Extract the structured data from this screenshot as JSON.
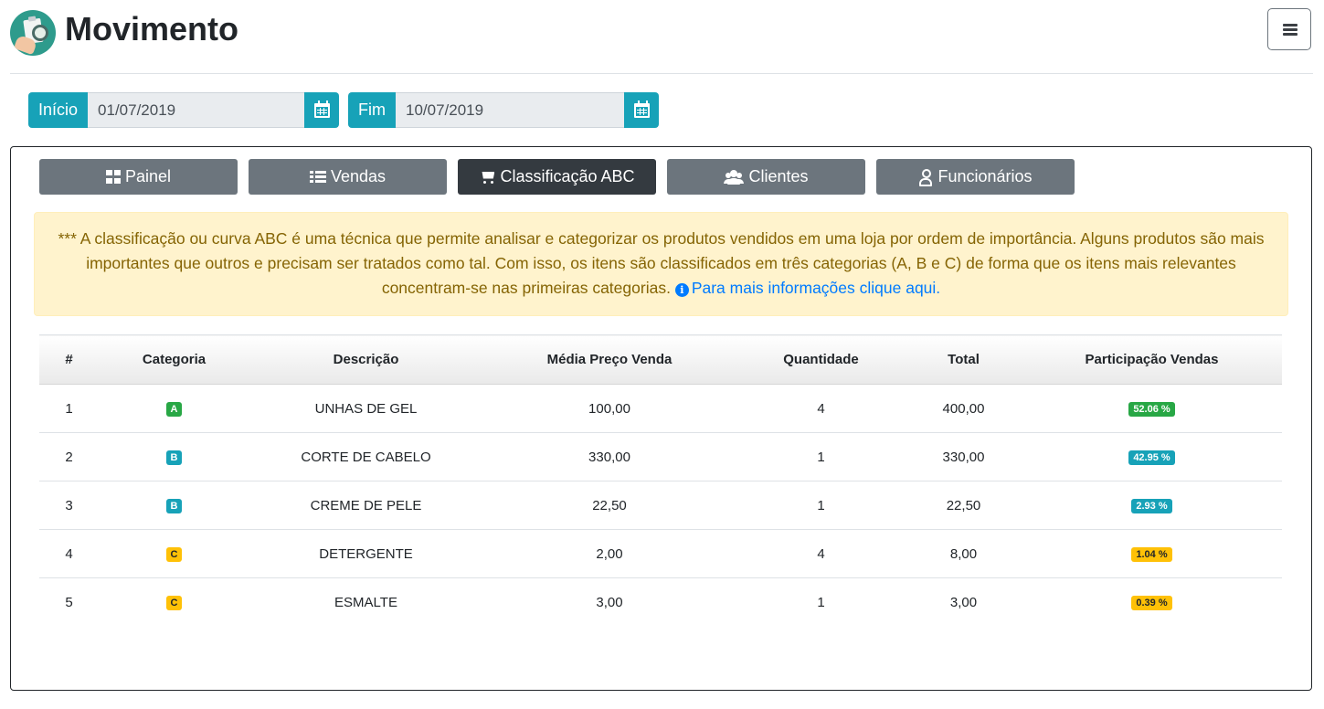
{
  "page": {
    "title": "Movimento"
  },
  "filters": {
    "start_label": "Início",
    "start_value": "01/07/2019",
    "end_label": "Fim",
    "end_value": "10/07/2019"
  },
  "tabs": [
    {
      "label": "Painel",
      "icon": "grid-icon",
      "active": false
    },
    {
      "label": "Vendas",
      "icon": "list-icon",
      "active": false
    },
    {
      "label": "Classificação ABC",
      "icon": "cart-icon",
      "active": true
    },
    {
      "label": "Clientes",
      "icon": "users-icon",
      "active": false
    },
    {
      "label": "Funcionários",
      "icon": "user-icon",
      "active": false
    }
  ],
  "alert": {
    "text": "*** A classificação ou curva ABC é uma técnica que permite analisar e categorizar os produtos vendidos em uma loja por ordem de importância. Alguns produtos são mais importantes que outros e precisam ser tratados como tal. Com isso, os itens são classificados em três categorias (A, B e C) de forma que os itens mais relevantes concentram-se nas primeiras categorias.",
    "link_text": "Para mais informações clique aqui."
  },
  "table": {
    "headers": [
      "#",
      "Categoria",
      "Descrição",
      "Média Preço Venda",
      "Quantidade",
      "Total",
      "Participação Vendas"
    ],
    "rows": [
      {
        "num": "1",
        "cat": "A",
        "desc": "UNHAS DE GEL",
        "avg": "100,00",
        "qty": "4",
        "total": "400,00",
        "share": "52.06 %"
      },
      {
        "num": "2",
        "cat": "B",
        "desc": "CORTE DE CABELO",
        "avg": "330,00",
        "qty": "1",
        "total": "330,00",
        "share": "42.95 %"
      },
      {
        "num": "3",
        "cat": "B",
        "desc": "CREME DE PELE",
        "avg": "22,50",
        "qty": "1",
        "total": "22,50",
        "share": "2.93 %"
      },
      {
        "num": "4",
        "cat": "C",
        "desc": "DETERGENTE",
        "avg": "2,00",
        "qty": "4",
        "total": "8,00",
        "share": "1.04 %"
      },
      {
        "num": "5",
        "cat": "C",
        "desc": "ESMALTE",
        "avg": "3,00",
        "qty": "1",
        "total": "3,00",
        "share": "0.39 %"
      }
    ]
  },
  "colors": {
    "A": "#28a745",
    "B": "#17a2b8",
    "C": "#ffc107",
    "accent": "#17a2b8"
  }
}
